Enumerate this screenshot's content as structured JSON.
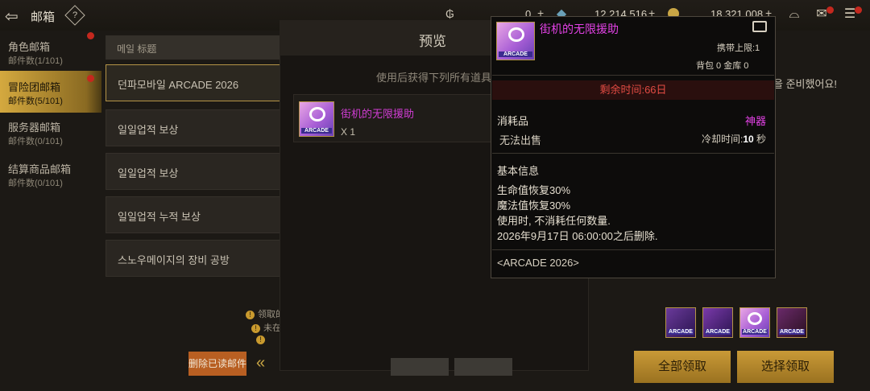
{
  "header": {
    "title": "邮箱",
    "help": "?"
  },
  "currencies": [
    {
      "value": "0",
      "color": "#6aa0b8"
    },
    {
      "value": "12,214,516",
      "color": "#c9a645"
    },
    {
      "value": "18,321,008",
      "color": "#b8b8b8"
    }
  ],
  "sidebar": {
    "items": [
      {
        "label": "角色邮箱",
        "count": "邮件数(1/101)"
      },
      {
        "label": "冒险团邮箱",
        "count": "邮件数(5/101)"
      },
      {
        "label": "服务器邮箱",
        "count": "邮件数(0/101)"
      },
      {
        "label": "结算商品邮箱",
        "count": "邮件数(0/101)"
      }
    ]
  },
  "mail_list": {
    "header": "메일 标题",
    "rows": [
      "던파모바일 ARCADE 2026",
      "일일업적 보상",
      "일일업적 보상",
      "일일업적 누적 보상",
      "스노우메이지의 장비 공방"
    ],
    "notes": [
      "领取的",
      "未在",
      ""
    ],
    "delete_read_label": "删除已读邮件"
  },
  "preview": {
    "title": "预览",
    "desc": "使用后获得下列所有道具",
    "item_name": "街机的无限援助",
    "item_qty": "X 1"
  },
  "background_text": "을 준비했어요!",
  "tooltip": {
    "name": "街机的无限援助",
    "icon_text": "ARCADE",
    "carry_limit": "携带上限:1",
    "bag": "背包 0 金库 0",
    "remaining_time": "剩余时间:66日",
    "type": "消耗品",
    "rarity": "神器",
    "no_sell": "无法出售",
    "cooldown_label": "冷却时间:",
    "cooldown_value": "10",
    "cooldown_unit": " 秒",
    "basic_info": "基本信息",
    "lines": [
      "生命值恢复30%",
      "魔法值恢复30%",
      "使用时, 不消耗任何数量.",
      "2026年9月17日 06:00:00之后删除."
    ],
    "tag": "<ARCADE 2026>"
  },
  "rewards_icons": [
    "ARCADE",
    "ARCADE",
    "ARCADE",
    "ARCADE"
  ],
  "actions": {
    "claim_all": "全部领取",
    "claim_selected": "选择领取"
  }
}
